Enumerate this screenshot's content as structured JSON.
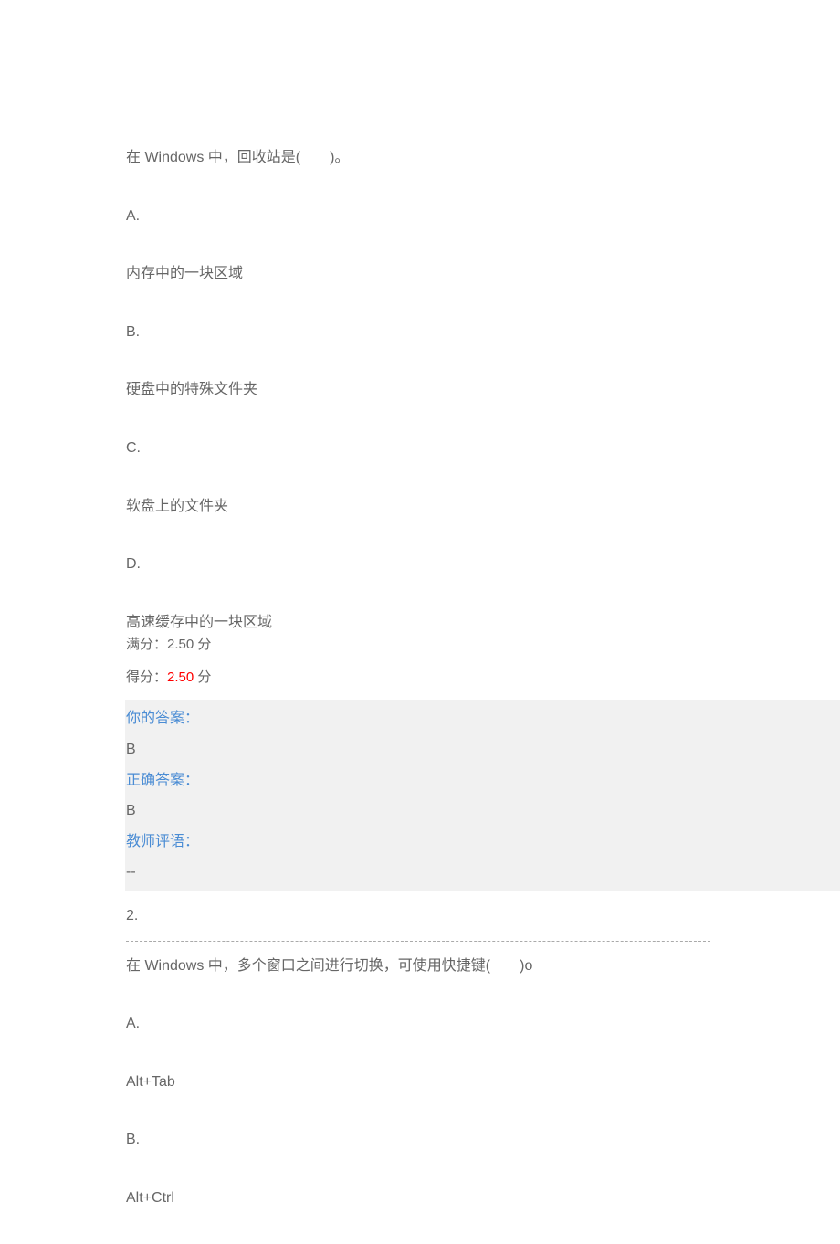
{
  "q1": {
    "text": "在 Windows 中，回收站是(　　)。",
    "options": [
      {
        "label": "A.",
        "content": "内存中的一块区域"
      },
      {
        "label": "B.",
        "content": "硬盘中的特殊文件夹"
      },
      {
        "label": "C.",
        "content": "软盘上的文件夹"
      },
      {
        "label": "D.",
        "content": "高速缓存中的一块区域"
      }
    ],
    "full_score_label": "满分：",
    "full_score_value": "2.50",
    "score_unit": " 分",
    "earned_label": "得分：",
    "earned_value": "2.50",
    "earned_unit": " 分",
    "your_answer_label": "你的答案：",
    "your_answer_value": "B",
    "correct_answer_label": "正确答案：",
    "correct_answer_value": "B",
    "teacher_comment_label": "教师评语：",
    "teacher_comment_value": "--"
  },
  "q2": {
    "number": "2.",
    "text": "在 Windows 中，多个窗口之间进行切换，可使用快捷键(　　)o",
    "options": [
      {
        "label": "A.",
        "content": "Alt+Tab"
      },
      {
        "label": "B.",
        "content": "Alt+Ctrl"
      }
    ]
  }
}
